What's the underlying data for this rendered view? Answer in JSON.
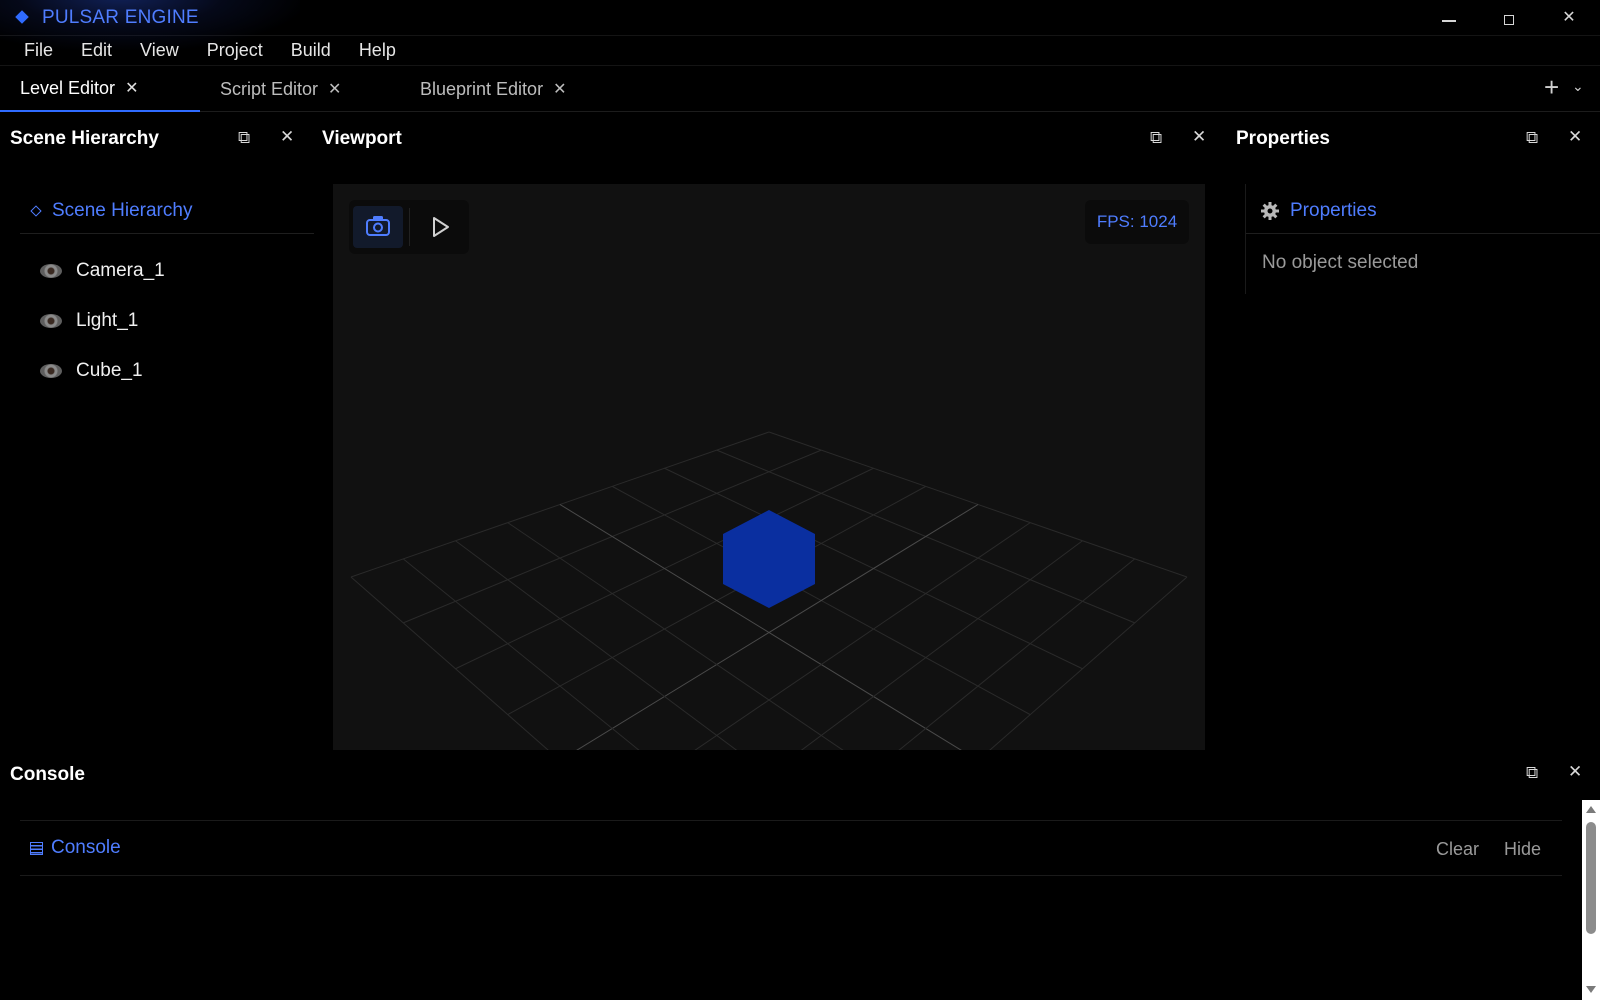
{
  "app": {
    "title": "PULSAR ENGINE",
    "accent": "#2f6bff"
  },
  "window_controls": {
    "minimize": "—",
    "maximize": "□",
    "close": "✕"
  },
  "menu": [
    "File",
    "Edit",
    "View",
    "Project",
    "Build",
    "Help"
  ],
  "tabs": [
    {
      "label": "Level Editor",
      "close": "✕",
      "active": true
    },
    {
      "label": "Script Editor",
      "close": "✕",
      "active": false
    },
    {
      "label": "Blueprint Editor",
      "close": "✕",
      "active": false
    }
  ],
  "tab_actions": {
    "add": "+",
    "more": "⌄"
  },
  "scene_hierarchy": {
    "panel_title": "Scene Hierarchy",
    "header": "Scene Hierarchy",
    "items": [
      "Camera_1",
      "Light_1",
      "Cube_1"
    ]
  },
  "viewport": {
    "panel_title": "Viewport",
    "fps_label": "FPS: 1024",
    "cube_color": "#0a2fa0"
  },
  "properties": {
    "panel_title": "Properties",
    "header": "Properties",
    "empty_text": "No object selected"
  },
  "console": {
    "panel_title": "Console",
    "header": "Console",
    "clear": "Clear",
    "hide": "Hide"
  },
  "panel_ctrls": {
    "popout": "⧉",
    "close": "✕"
  }
}
